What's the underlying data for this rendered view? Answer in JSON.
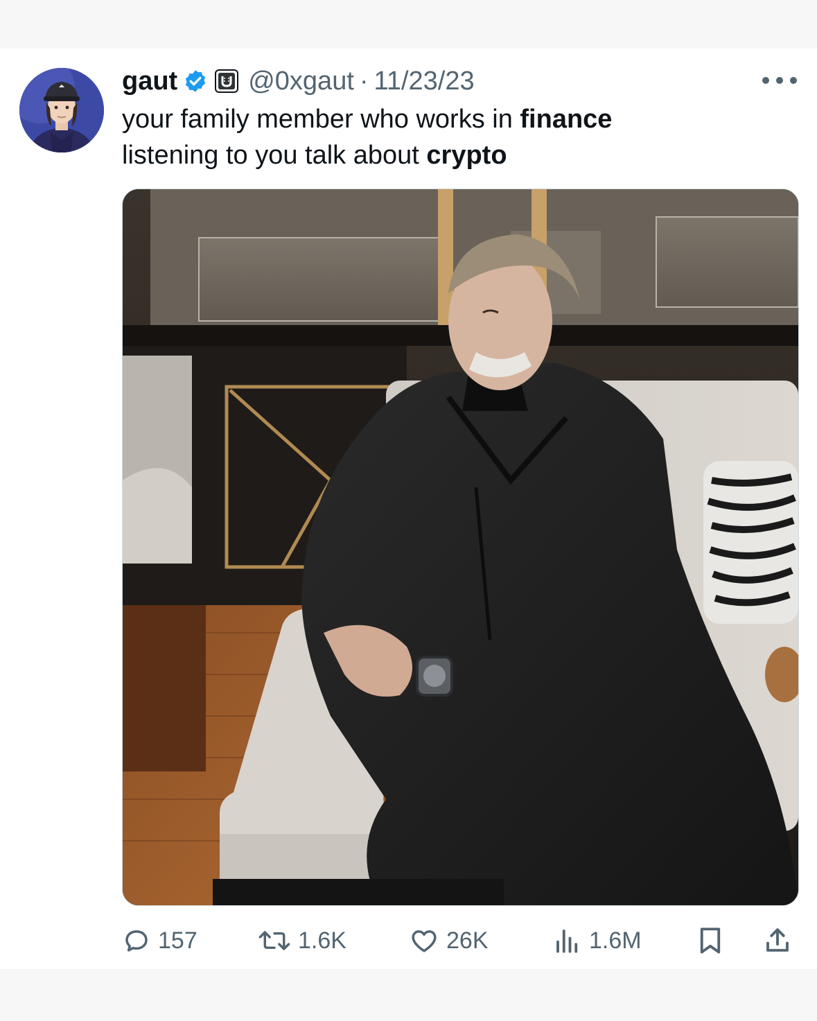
{
  "tweet": {
    "author": {
      "display_name": "gaut",
      "verified_icon": "verified-badge-icon",
      "affiliate_icon": "affiliate-u-badge-icon",
      "handle": "@0xgaut",
      "avatar_icon": "avatar-cartoon-man-cap"
    },
    "separator": "·",
    "date": "11/23/23",
    "more_icon": "more-options-icon",
    "text": {
      "line1_prefix": "your family member who works in ",
      "line1_bold": "finance",
      "line2_prefix": "listening to you talk about ",
      "line2_bold": "crypto"
    },
    "media_icon": "photo-man-in-black-coat-on-sofa",
    "metrics": {
      "replies": "157",
      "reposts": "1.6K",
      "likes": "26K",
      "views": "1.6M"
    },
    "action_icons": [
      "reply-icon",
      "repost-icon",
      "like-icon",
      "views-icon",
      "bookmark-icon",
      "share-icon"
    ],
    "colors": {
      "text": "#0f1419",
      "muted": "#536471",
      "verified_blue": "#1d9bf0"
    }
  }
}
